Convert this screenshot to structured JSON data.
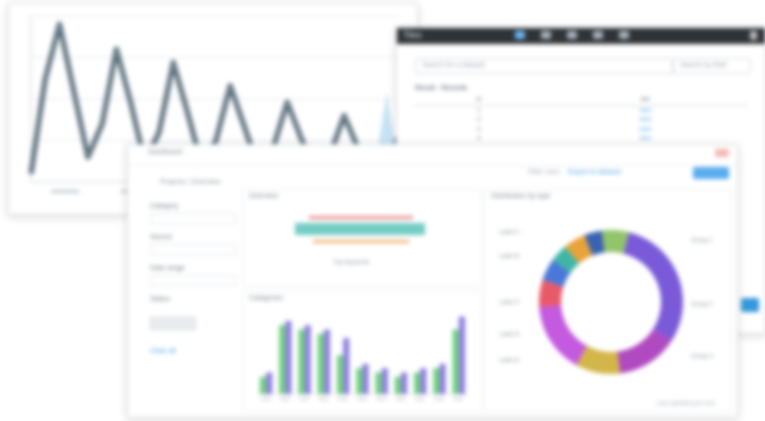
{
  "table_app": {
    "title": "Tiles",
    "filter_placeholder": "Search for a dataset",
    "secondary_placeholder": "Search by field",
    "section_label": "Result - Records",
    "columns": [
      "id",
      "link"
    ],
    "rows": [
      [
        "1",
        "view"
      ],
      [
        "2",
        "view"
      ],
      [
        "3",
        "view"
      ],
      [
        "4",
        "view"
      ],
      [
        "5",
        "view"
      ],
      [
        "6",
        "view"
      ],
      [
        "7",
        "view"
      ],
      [
        "8",
        "view"
      ],
      [
        "9",
        "view"
      ],
      [
        "10",
        "view"
      ]
    ]
  },
  "dashboard": {
    "breadcrumb": "Dashboard",
    "subcrumb": "Projects / Overview",
    "top_text": "Filter view",
    "top_link": "Export to dataset",
    "sidebar": {
      "labels": [
        "Category",
        "Source",
        "Date range",
        "Status"
      ],
      "button_label": "Apply",
      "link_label": "Clear all"
    },
    "panel_wordcloud_title": "Overview",
    "panel_bar_title": "Categories",
    "panel_donut_title": "Distribution by type",
    "wordmark_caption": "Top keywords",
    "donut_legend": [
      "Label A",
      "Label B",
      "Label C",
      "Label D",
      "Label E"
    ],
    "right_legend": [
      "Group 1",
      "Group 2",
      "Group 3"
    ],
    "footer": "Last updated just now"
  },
  "chart_data": [
    {
      "type": "line",
      "x": [
        0,
        1,
        2,
        3,
        4,
        5,
        6,
        7,
        8,
        9,
        10,
        11,
        12,
        13,
        14,
        15,
        16,
        17,
        18,
        19,
        20,
        21,
        22,
        23,
        24,
        25,
        26
      ],
      "series": [
        {
          "values": [
            5,
            62,
            95,
            55,
            15,
            35,
            80,
            48,
            12,
            30,
            72,
            42,
            10,
            25,
            58,
            33,
            8,
            20,
            48,
            26,
            6,
            16,
            40,
            20,
            5,
            14,
            30
          ]
        }
      ],
      "ylim": [
        0,
        100
      ],
      "grid": true
    },
    {
      "type": "bar",
      "categories": [
        "A",
        "B",
        "C",
        "D",
        "E",
        "F",
        "G",
        "H",
        "I",
        "J",
        "K"
      ],
      "series": [
        {
          "values": [
            8,
            32,
            30,
            28,
            18,
            12,
            10,
            8,
            10,
            12,
            30
          ],
          "color": "#6fcf7f"
        },
        {
          "values": [
            10,
            34,
            32,
            30,
            26,
            14,
            12,
            10,
            12,
            14,
            36
          ],
          "color": "#8f7fe0"
        }
      ],
      "ylim": [
        0,
        40
      ]
    },
    {
      "type": "pie",
      "donut": true,
      "values": [
        30,
        14,
        10,
        16,
        6,
        5,
        4,
        5,
        4,
        6
      ],
      "colors": [
        "#7a5ad8",
        "#b04ac0",
        "#d3b64a",
        "#c45adf",
        "#e85a6a",
        "#4a78d8",
        "#3fb6a5",
        "#e8a33a",
        "#3a62b0",
        "#92c46a"
      ]
    }
  ]
}
